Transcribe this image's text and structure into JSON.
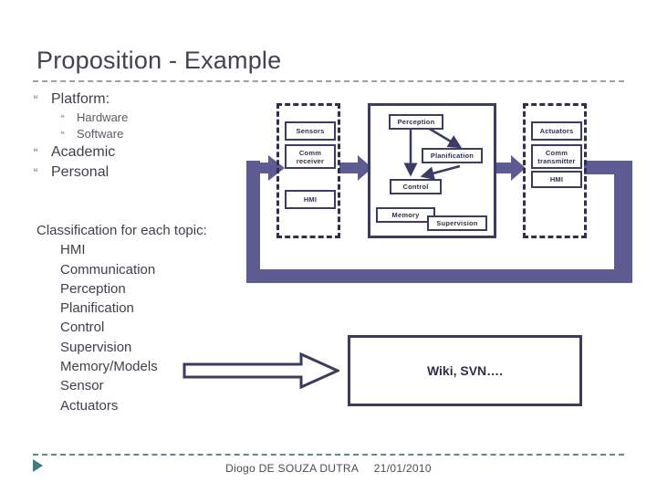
{
  "slide": {
    "title": "Proposition - Example",
    "bullet_glyph": "❝"
  },
  "bullets": [
    {
      "level": 1,
      "label": "Platform:"
    },
    {
      "level": 2,
      "label": "Hardware"
    },
    {
      "level": 2,
      "label": "Software"
    },
    {
      "level": 1,
      "label": "Academic"
    },
    {
      "level": 1,
      "label": "Personal"
    }
  ],
  "classification": {
    "heading": "Classification for each topic:",
    "items": [
      "HMI",
      "Communication",
      "Perception",
      "Planification",
      "Control",
      "Supervision",
      "Memory/Models",
      "Sensor",
      "Actuators"
    ]
  },
  "diagram": {
    "input_group": {
      "nodes": [
        "Sensors",
        "Comm\nreceiver",
        "HMI"
      ]
    },
    "core_group": {
      "nodes": [
        "Perception",
        "Planification",
        "Control",
        "Memory",
        "Supervision"
      ]
    },
    "output_group": {
      "nodes": [
        "Actuators",
        "Comm\ntransmitter",
        "HMI"
      ]
    },
    "colors": {
      "band": "#5c5c92",
      "box_border": "#3b3b63",
      "dashed_border": "#2f2f4f"
    }
  },
  "tools": {
    "wiki_label": "Wiki, SVN…."
  },
  "footer": {
    "author": "Diogo DE SOUZA DUTRA",
    "date": "21/01/2010"
  }
}
